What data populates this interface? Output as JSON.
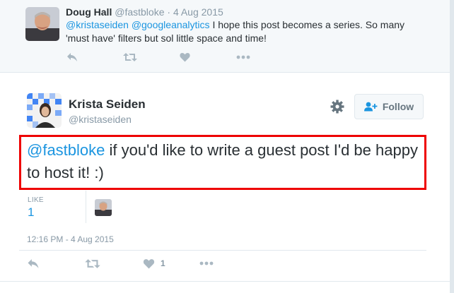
{
  "reply": {
    "author_name": "Doug Hall",
    "author_handle": "@fastbloke",
    "separator": "·",
    "date": "4 Aug 2015",
    "mention_1": "@kristaseiden",
    "mention_2": "@googleanalytics",
    "text": "I hope this post becomes a series. So many 'must have' filters but sol little space and time!"
  },
  "tweet": {
    "author_name": "Krista Seiden",
    "author_handle": "@kristaseiden",
    "follow_label": "Follow",
    "mention": "@fastbloke",
    "text": "if you'd like to write a guest post I'd be happy to host it! :)",
    "like_label": "LIKE",
    "like_count": "1",
    "timestamp": "12:16 PM - 4 Aug 2015",
    "action_like_count": "1"
  },
  "colors": {
    "accent": "#1b95e0",
    "muted": "#8899a6",
    "highlight_border": "#ee0000"
  },
  "icons": [
    "reply-icon",
    "retweet-icon",
    "like-icon",
    "more-icon",
    "gear-icon",
    "follow-person-icon"
  ]
}
